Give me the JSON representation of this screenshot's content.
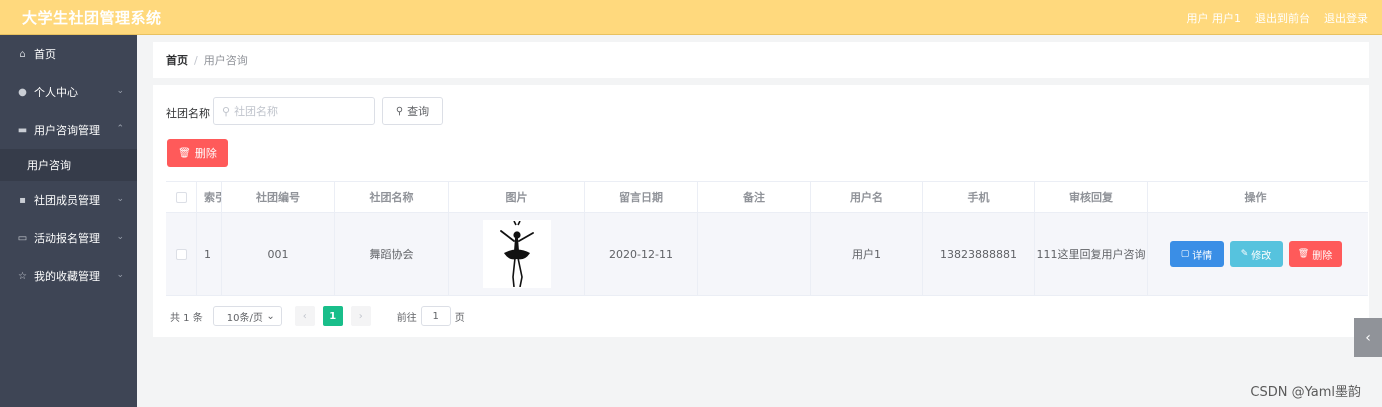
{
  "app": {
    "title": "大学生社团管理系统"
  },
  "header": {
    "user": "用户 用户1",
    "back_to_front": "退出到前台",
    "logout": "退出登录"
  },
  "sidebar": {
    "items": [
      {
        "label": "首页",
        "icon": "home-icon"
      },
      {
        "label": "个人中心",
        "icon": "user-icon"
      },
      {
        "label": "用户咨询管理",
        "icon": "chat-icon",
        "expanded": true
      },
      {
        "label": "社团成员管理",
        "icon": "members-icon"
      },
      {
        "label": "活动报名管理",
        "icon": "signup-icon"
      },
      {
        "label": "我的收藏管理",
        "icon": "bookmark-icon"
      }
    ],
    "submenu": {
      "label": "用户咨询"
    }
  },
  "breadcrumb": {
    "home": "首页",
    "separator": "/",
    "current": "用户咨询"
  },
  "search": {
    "label": "社团名称",
    "placeholder": "社团名称",
    "button": "查询"
  },
  "actions": {
    "delete_label": "删除"
  },
  "table": {
    "columns": [
      "索引",
      "社团编号",
      "社团名称",
      "图片",
      "留言日期",
      "备注",
      "用户名",
      "手机",
      "审核回复",
      "操作"
    ],
    "rows": [
      {
        "index": "1",
        "club_no": "001",
        "club_name": "舞蹈协会",
        "image": "ballerina-silhouette",
        "date": "2020-12-11",
        "note": "",
        "username": "用户1",
        "phone": "13823888881",
        "reply": "111这里回复用户咨询"
      }
    ],
    "ops": {
      "detail": "详情",
      "edit": "修改",
      "delete": "删除"
    }
  },
  "pagination": {
    "total": "共 1 条",
    "page_size": "10条/页",
    "current_page": "1",
    "goto": "前往",
    "goto_value": "1",
    "page_unit": "页"
  },
  "watermark": "CSDN @Yaml墨韵",
  "colors": {
    "header": "#ffd97d",
    "sidebar": "#3e4555",
    "danger": "#ff5a5a",
    "primary": "#3a8ee6",
    "info": "#56c3de",
    "active_page": "#19be8a"
  }
}
